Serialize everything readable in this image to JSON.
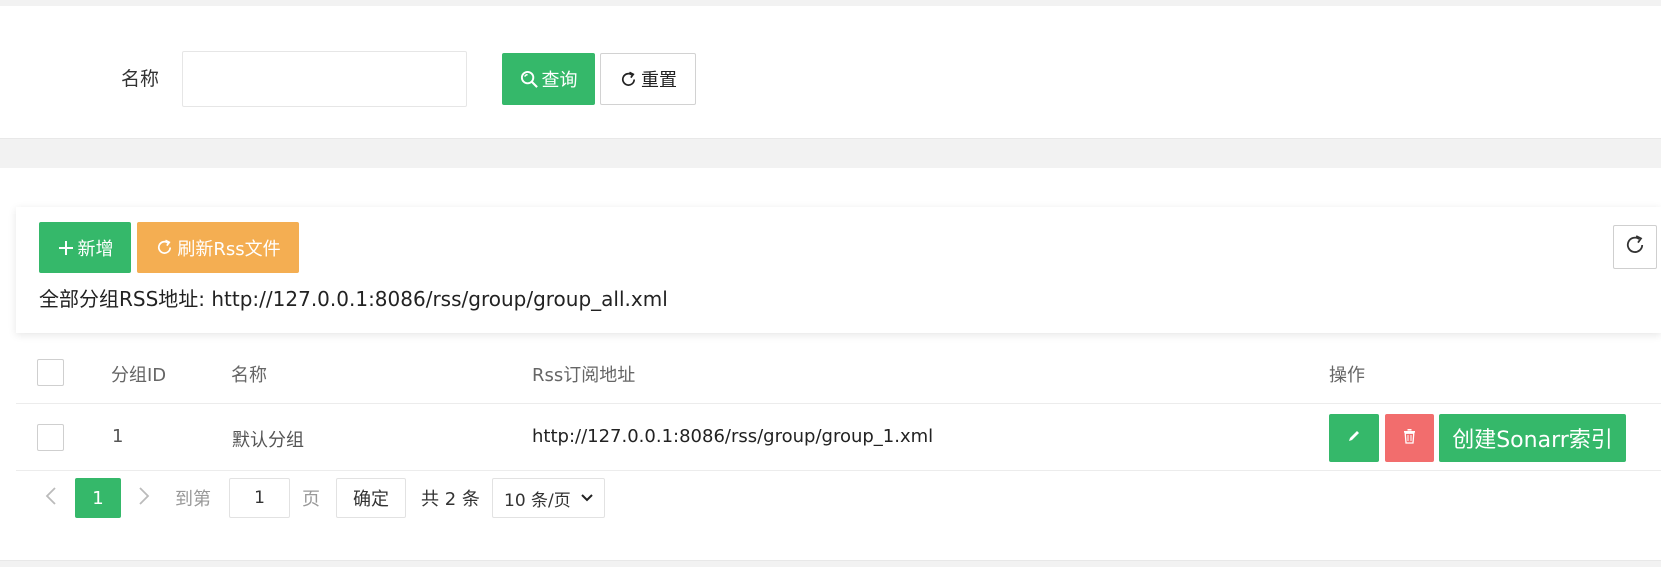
{
  "search": {
    "name_label": "名称",
    "name_value": "",
    "name_placeholder": "",
    "query_label": "查询",
    "reset_label": "重置"
  },
  "toolbar": {
    "add_label": "新增",
    "refresh_rss_label": "刷新Rss文件",
    "rss_all_text": "全部分组RSS地址: http://127.0.0.1:8086/rss/group/group_all.xml"
  },
  "table": {
    "columns": [
      "分组ID",
      "名称",
      "Rss订阅地址",
      "操作"
    ],
    "rows": [
      {
        "id": "1",
        "name": "默认分组",
        "rss": "http://127.0.0.1:8086/rss/group/group_1.xml",
        "sonarr_label": "创建Sonarr索引"
      }
    ]
  },
  "pagination": {
    "current_page": "1",
    "goto_label": "到第",
    "goto_value": "1",
    "page_label": "页",
    "confirm_label": "确定",
    "total_text": "共 2 条",
    "page_size": "10 条/页"
  },
  "colors": {
    "primary": "#35b86a",
    "warning": "#f4ae52",
    "danger": "#f26d6d"
  },
  "icons": [
    "search-icon",
    "refresh-icon",
    "plus-icon",
    "pencil-icon",
    "trash-icon",
    "chevron-left-icon",
    "chevron-right-icon",
    "chevron-down-icon"
  ]
}
